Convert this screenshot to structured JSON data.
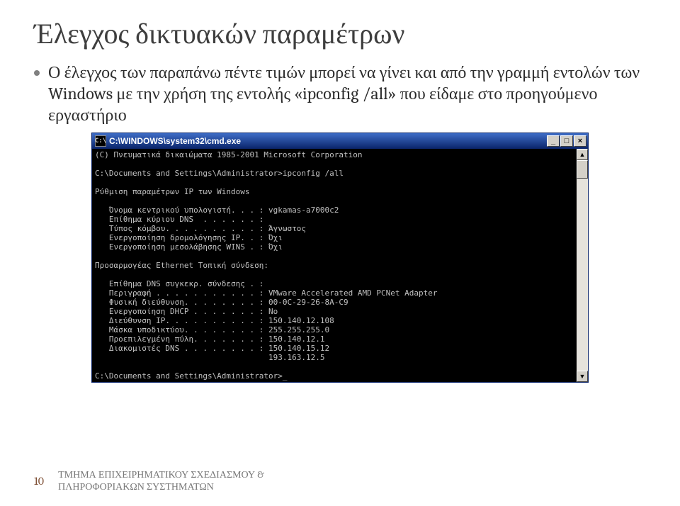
{
  "title": "Έλεγχος δικτυακών παραμέτρων",
  "bullet": "Ο έλεγχος των παραπάνω πέντε τιμών μπορεί να γίνει και από την γραμμή εντολών των Windows με την χρήση της εντολής «ipconfig /all» που είδαμε στο προηγούμενο εργαστήριο",
  "cmd": {
    "icon_text": "C:\\",
    "title": "C:\\WINDOWS\\system32\\cmd.exe",
    "min": "_",
    "max": "□",
    "close": "×",
    "scroll_up": "▲",
    "scroll_down": "▼",
    "lines": [
      "(C) Πνευματικά δικαιώματα 1985-2001 Microsoft Corporation",
      "",
      "C:\\Documents and Settings\\Administrator>ipconfig /all",
      "",
      "Ρύθμιση παραμέτρων IP των Windows",
      "",
      "   Όνομα κεντρικού υπολογιστή. . . : vgkamas-a7000c2",
      "   Επίθημα κύριου DNS  . . . . . . :",
      "   Τύπος κόμβου. . . . . . . . . . : Άγνωστος",
      "   Ενεργοποίηση δρομολόγησης IP. . : Όχι",
      "   Ενεργοποίηση μεσολάβησης WINS . : Όχι",
      "",
      "Προσαρμογέας Ethernet Τοπική σύνδεση:",
      "",
      "   Επίθημα DNS συγκεκρ. σύνδεσης . :",
      "   Περιγραφή . . . . . . . . . . . : VMware Accelerated AMD PCNet Adapter",
      "   Φυσική διεύθυνση. . . . . . . . : 00-0C-29-26-8A-C9",
      "   Ενεργοποίηση DHCP . . . . . . . : No",
      "   Διεύθυνση IP. . . . . . . . . . : 150.140.12.108",
      "   Μάσκα υποδικτύου. . . . . . . . : 255.255.255.0",
      "   Προεπιλεγμένη πύλη. . . . . . . : 150.140.12.1",
      "   Διακομιστές DNS . . . . . . . . : 150.140.15.12",
      "                                     193.163.12.5",
      "",
      "C:\\Documents and Settings\\Administrator>_"
    ]
  },
  "footer": {
    "page": "10",
    "line1": "ΤΜΗΜΑ ΕΠΙΧΕΙΡΗΜΑΤΙΚΟΥ ΣΧΕΔΙΑΣΜΟΥ &",
    "line2": "ΠΛΗΡΟΦΟΡΙΑΚΩΝ ΣΥΣΤΗΜΑΤΩΝ"
  }
}
